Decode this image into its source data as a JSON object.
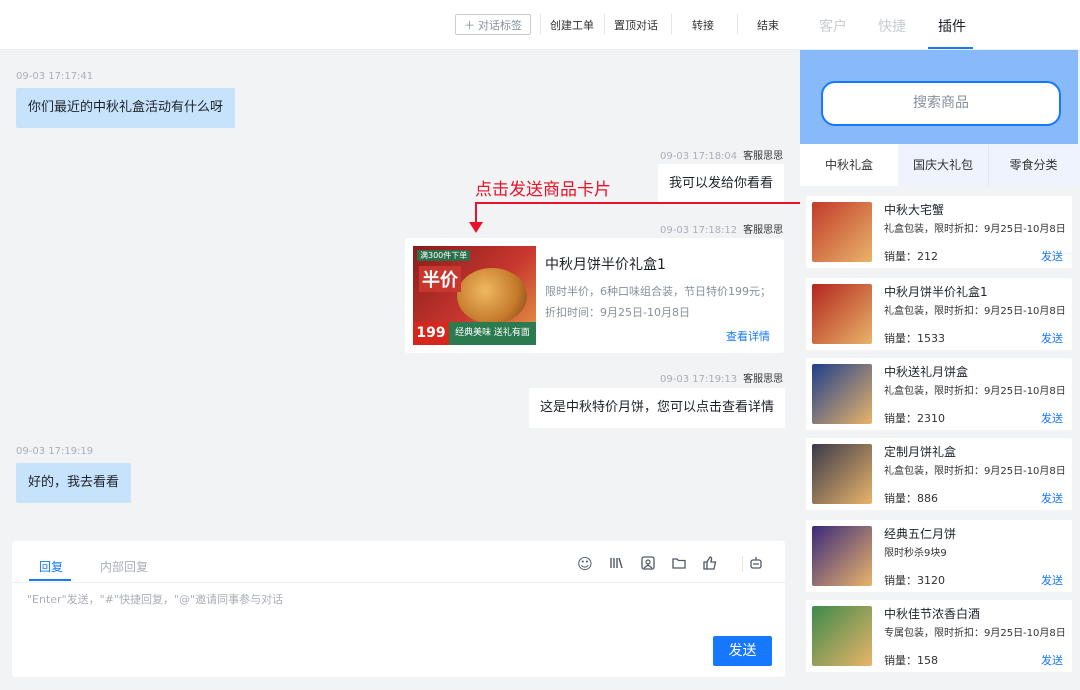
{
  "topbar": {
    "tag_button": "对话标签",
    "actions": [
      "创建工单",
      "置顶对话",
      "转接",
      "结束"
    ]
  },
  "right_tabs": [
    "客户",
    "快捷",
    "插件"
  ],
  "chat": {
    "messages": [
      {
        "time": "09-03 17:17:41",
        "text": "你们最近的中秋礼盒活动有什么呀"
      },
      {
        "time": "09-03 17:18:04",
        "sender": "客服思思",
        "text": "我可以发给你看看"
      },
      {
        "time": "09-03 17:18:12",
        "sender": "客服思思"
      },
      {
        "time": "09-03 17:19:13",
        "sender": "客服思思",
        "text": "这是中秋特价月饼，您可以点击查看详情"
      },
      {
        "time": "09-03 17:19:19",
        "text": "好的，我去看看"
      }
    ],
    "product_card": {
      "title": "中秋月饼半价礼盒1",
      "desc": "限时半价，6种口味组合装，节日特价199元；",
      "time": "折扣时间：9月25日-10月8日",
      "link": "查看详情",
      "img_tag": "满300件下单",
      "img_big": "半价",
      "img_price": "199",
      "img_slogan": "经典美味 送礼有面"
    },
    "annotation": "点击发送商品卡片"
  },
  "composer": {
    "tabs": [
      "回复",
      "内部回复"
    ],
    "placeholder": "\"Enter\"发送，\"#\"快捷回复，\"@\"邀请同事参与对话",
    "send": "发送"
  },
  "plugin": {
    "search_placeholder": "搜索商品",
    "categories": [
      "中秋礼盒",
      "国庆大礼包",
      "零食分类"
    ],
    "sales_label": "销量：",
    "send_label": "发送",
    "goods": [
      {
        "name": "中秋大宅蟹",
        "desc": "礼盒包装，限时折扣：9月25日-10月8日",
        "sales": "212",
        "color": "#c23b2a"
      },
      {
        "name": "中秋月饼半价礼盒1",
        "desc": "礼盒包装，限时折扣：9月25日-10月8日",
        "sales": "1533",
        "color": "#b3261e"
      },
      {
        "name": "中秋送礼月饼盒",
        "desc": "礼盒包装，限时折扣：9月25日-10月8日",
        "sales": "2310",
        "color": "#1e3f8a"
      },
      {
        "name": "定制月饼礼盒",
        "desc": "礼盒包装，限时折扣：9月25日-10月8日",
        "sales": "886",
        "color": "#3a3a4a"
      },
      {
        "name": "经典五仁月饼",
        "desc": "限时秒杀9块9",
        "sales": "3120",
        "color": "#3b2a7a"
      },
      {
        "name": "中秋佳节浓香白酒",
        "desc": "专属包装，限时折扣：9月25日-10月8日",
        "sales": "158",
        "color": "#3e8a4a"
      }
    ]
  }
}
